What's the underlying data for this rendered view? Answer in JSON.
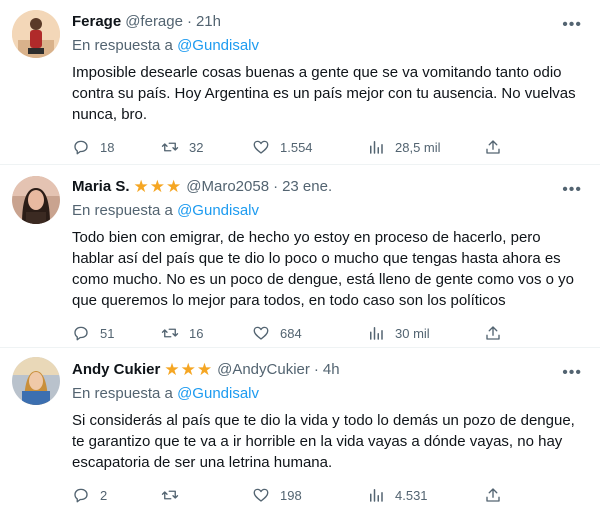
{
  "tweets": [
    {
      "name": "Ferage",
      "handle": "@ferage",
      "time": "21h",
      "stars": 0,
      "reply_prefix": "En respuesta a",
      "reply_to": "@Gundisalv",
      "lines": [
        "Imposible desearle cosas buenas a gente que se va vomitando tanto odio",
        "contra su país. Hoy Argentina es un país mejor con tu ausencia. No vuelvas",
        "nunca, bro."
      ],
      "replies": "18",
      "retweets": "32",
      "likes": "1.554",
      "views": "28,5 mil"
    },
    {
      "name": "Maria S.",
      "handle": "@Maro2058",
      "time": "23 ene.",
      "stars": 3,
      "reply_prefix": "En respuesta a",
      "reply_to": "@Gundisalv",
      "lines": [
        "Todo bien con emigrar, de hecho yo estoy en proceso de hacerlo, pero",
        "hablar así del país que te dio lo poco o mucho que tengas hasta ahora es",
        "como mucho. No es un poco de dengue, está lleno de gente como vos o yo",
        "que queremos lo mejor para todos, en todo caso son los políticos"
      ],
      "replies": "51",
      "retweets": "16",
      "likes": "684",
      "views": "30 mil"
    },
    {
      "name": "Andy Cukier",
      "handle": "@AndyCukier",
      "time": "4h",
      "stars": 3,
      "reply_prefix": "En respuesta a",
      "reply_to": "@Gundisalv",
      "lines": [
        "Si considerás al país que te dio la vida y todo lo demás un pozo de dengue,",
        "te garantizo que te va a ir horrible en la vida vayas a dónde vayas, no hay",
        "escapatoria de ser una letrina humana."
      ],
      "replies": "2",
      "retweets": "",
      "likes": "198",
      "views": "4.531"
    }
  ],
  "icons": {
    "reply": "comment-bubble-icon",
    "retweet": "retweet-arrows-icon",
    "like": "heart-outline-icon",
    "views": "bar-chart-icon",
    "share": "share-upload-icon",
    "more": "more-dots-icon",
    "star": "star-icon"
  },
  "colors": {
    "text": "#0f1419",
    "muted": "#536471",
    "link": "#1d9bf0",
    "star": "#f5a623",
    "divider": "#eff3f4"
  }
}
